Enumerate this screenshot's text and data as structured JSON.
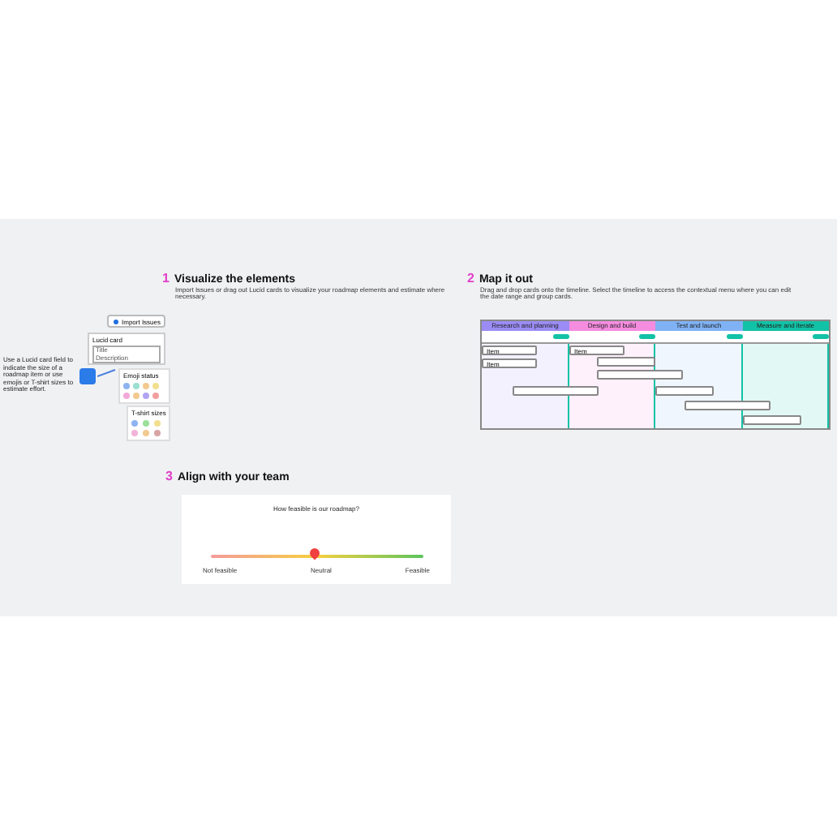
{
  "sections": [
    {
      "number": "1",
      "title": "Visualize the elements",
      "description": "Import Issues or drag out Lucid cards to visualize your roadmap elements and estimate where necessary."
    },
    {
      "number": "2",
      "title": "Map it out",
      "description": "Drag and drop cards onto the timeline. Select the timeline to access the contextual menu where you can edit the date range and group cards."
    },
    {
      "number": "3",
      "title": "Align with your team"
    }
  ],
  "import_button": {
    "label": "Import Issues"
  },
  "lucid_card": {
    "title": "Lucid card",
    "field_lines": [
      "Title",
      "Description"
    ]
  },
  "note": "Use a Lucid card field to indicate the size of a roadmap item or use emojis or T-shirt sizes to estimate effort.",
  "palettes": [
    {
      "title": "Emoji status",
      "dots": [
        {
          "color": "#8fb3f2"
        },
        {
          "color": "#9be0d0"
        },
        {
          "color": "#f2c98f"
        },
        {
          "color": "#f2df8f"
        },
        {
          "color": "#f2a9d9"
        },
        {
          "color": "#f2c98f"
        },
        {
          "color": "#b0a4f2"
        },
        {
          "color": "#f29f9f"
        }
      ]
    },
    {
      "title": "T-shirt sizes",
      "dots": [
        {
          "color": "#8fb3f2"
        },
        {
          "color": "#9be09b"
        },
        {
          "color": "#f2df8f"
        },
        {
          "color": "#f2b3d9"
        },
        {
          "color": "#f2c98f"
        },
        {
          "color": "#d9a4a4"
        }
      ]
    }
  ],
  "timeline": {
    "columns": [
      {
        "label": "Research and planning",
        "color": "#9b8cf5"
      },
      {
        "label": "Design and build",
        "color": "#f58ce0"
      },
      {
        "label": "Test and launch",
        "color": "#7fb2f5"
      },
      {
        "label": "Measure and iterate",
        "color": "#12c2a6"
      }
    ],
    "cards": [
      {
        "kind": "labeled",
        "label": "Item"
      },
      {
        "kind": "labeled",
        "label": "Item"
      },
      {
        "kind": "labeled",
        "label": "Item"
      },
      {
        "kind": "blank"
      },
      {
        "kind": "blank"
      },
      {
        "kind": "blank"
      },
      {
        "kind": "blank"
      },
      {
        "kind": "blank"
      },
      {
        "kind": "blank"
      }
    ]
  },
  "survey": {
    "question": "How feasible is our roadmap?",
    "level": 0.49,
    "labels": [
      "Not feasible",
      "Neutral",
      "Feasible"
    ]
  }
}
